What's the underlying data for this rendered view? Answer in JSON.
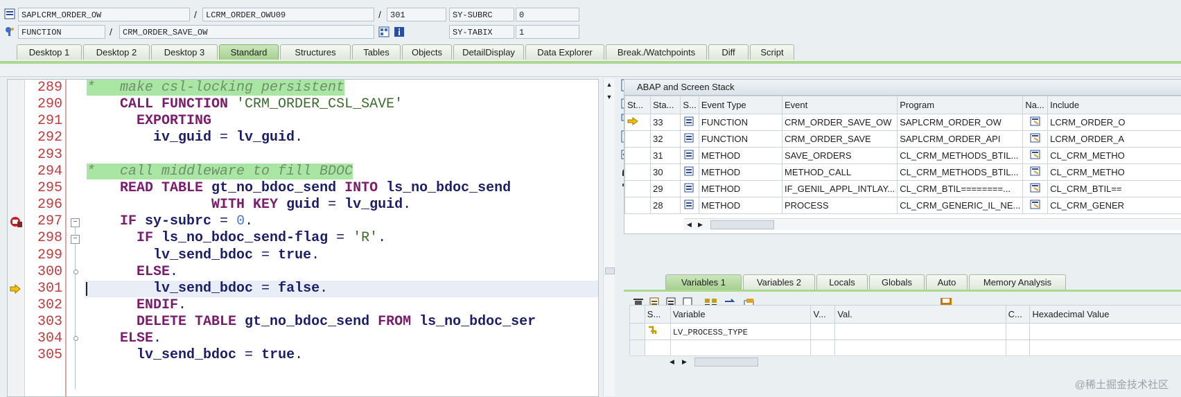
{
  "header": {
    "row1": {
      "program": "SAPLCRM_ORDER_OW",
      "include": "LCRM_ORDER_OWU09",
      "line": "301",
      "sys_field": "SY-SUBRC",
      "sys_value": "0"
    },
    "row2": {
      "type": "FUNCTION",
      "name": "CRM_ORDER_SAVE_OW",
      "sys_field": "SY-TABIX",
      "sys_value": "1"
    },
    "separator": "/"
  },
  "tabs": [
    "Desktop 1",
    "Desktop 2",
    "Desktop 3",
    "Standard",
    "Structures",
    "Tables",
    "Objects",
    "DetailDisplay",
    "Data Explorer",
    "Break./Watchpoints",
    "Diff",
    "Script"
  ],
  "active_tab": "Standard",
  "code": {
    "lines": [
      {
        "no": "289",
        "segs": [
          {
            "t": "*   make csl-locking persistent",
            "c": "cmt"
          }
        ]
      },
      {
        "no": "290",
        "segs": [
          {
            "t": "    ",
            "c": "op"
          },
          {
            "t": "CALL FUNCTION ",
            "c": "kw"
          },
          {
            "t": "'CRM_ORDER_CSL_SAVE'",
            "c": "str"
          }
        ]
      },
      {
        "no": "291",
        "segs": [
          {
            "t": "      ",
            "c": "op"
          },
          {
            "t": "EXPORTING",
            "c": "kw"
          }
        ]
      },
      {
        "no": "292",
        "segs": [
          {
            "t": "        ",
            "c": "op"
          },
          {
            "t": "iv_guid",
            "c": "id"
          },
          {
            "t": " = ",
            "c": "op"
          },
          {
            "t": "lv_guid",
            "c": "id"
          },
          {
            "t": ".",
            "c": "op"
          }
        ]
      },
      {
        "no": "293",
        "segs": []
      },
      {
        "no": "294",
        "segs": [
          {
            "t": "*   call middleware to fill BDOC",
            "c": "cmt"
          }
        ]
      },
      {
        "no": "295",
        "segs": [
          {
            "t": "    ",
            "c": "op"
          },
          {
            "t": "READ TABLE ",
            "c": "kw"
          },
          {
            "t": "gt_no_bdoc_send",
            "c": "id"
          },
          {
            "t": " INTO ",
            "c": "kw"
          },
          {
            "t": "ls_no_bdoc_send",
            "c": "id"
          }
        ]
      },
      {
        "no": "296",
        "segs": [
          {
            "t": "               ",
            "c": "op"
          },
          {
            "t": "WITH KEY ",
            "c": "kw"
          },
          {
            "t": "guid",
            "c": "id"
          },
          {
            "t": " = ",
            "c": "op"
          },
          {
            "t": "lv_guid",
            "c": "id"
          },
          {
            "t": ".",
            "c": "op"
          }
        ]
      },
      {
        "no": "297",
        "segs": [
          {
            "t": "    ",
            "c": "op"
          },
          {
            "t": "IF ",
            "c": "kw"
          },
          {
            "t": "sy-subrc",
            "c": "id"
          },
          {
            "t": " = ",
            "c": "op"
          },
          {
            "t": "0",
            "c": "num"
          },
          {
            "t": ".",
            "c": "op"
          }
        ]
      },
      {
        "no": "298",
        "segs": [
          {
            "t": "      ",
            "c": "op"
          },
          {
            "t": "IF ",
            "c": "kw"
          },
          {
            "t": "ls_no_bdoc_send-flag",
            "c": "id"
          },
          {
            "t": " = ",
            "c": "op"
          },
          {
            "t": "'R'",
            "c": "str"
          },
          {
            "t": ".",
            "c": "op"
          }
        ]
      },
      {
        "no": "299",
        "segs": [
          {
            "t": "        ",
            "c": "op"
          },
          {
            "t": "lv_send_bdoc",
            "c": "id"
          },
          {
            "t": " = ",
            "c": "op"
          },
          {
            "t": "true",
            "c": "id"
          },
          {
            "t": ".",
            "c": "op"
          }
        ]
      },
      {
        "no": "300",
        "segs": [
          {
            "t": "      ",
            "c": "op"
          },
          {
            "t": "ELSE",
            "c": "kw"
          },
          {
            "t": ".",
            "c": "op"
          }
        ]
      },
      {
        "no": "301",
        "segs": [
          {
            "t": "        ",
            "c": "op"
          },
          {
            "t": "lv_send_bdoc",
            "c": "id"
          },
          {
            "t": " = ",
            "c": "op"
          },
          {
            "t": "false",
            "c": "id"
          },
          {
            "t": ".",
            "c": "op"
          }
        ]
      },
      {
        "no": "302",
        "segs": [
          {
            "t": "      ",
            "c": "op"
          },
          {
            "t": "ENDIF",
            "c": "kw"
          },
          {
            "t": ".",
            "c": "op"
          }
        ]
      },
      {
        "no": "303",
        "segs": [
          {
            "t": "      ",
            "c": "op"
          },
          {
            "t": "DELETE TABLE ",
            "c": "kw"
          },
          {
            "t": "gt_no_bdoc_send",
            "c": "id"
          },
          {
            "t": " FROM ",
            "c": "kw"
          },
          {
            "t": "ls_no_bdoc_ser",
            "c": "id"
          }
        ]
      },
      {
        "no": "304",
        "segs": [
          {
            "t": "    ",
            "c": "op"
          },
          {
            "t": "ELSE",
            "c": "kw"
          },
          {
            "t": ".",
            "c": "op"
          }
        ]
      },
      {
        "no": "305",
        "segs": [
          {
            "t": "      ",
            "c": "op"
          },
          {
            "t": "lv_send_bdoc",
            "c": "id"
          },
          {
            "t": " = ",
            "c": "op"
          },
          {
            "t": "true",
            "c": "id"
          },
          {
            "t": ".",
            "c": "op"
          }
        ]
      }
    ],
    "current_line": "301",
    "breakpoint_line": "297"
  },
  "stack": {
    "title": "ABAP and Screen Stack",
    "columns": [
      "St...",
      "Sta...",
      "S...",
      "Event Type",
      "Event",
      "Program",
      "Na...",
      "Include"
    ],
    "rows": [
      {
        "current": true,
        "level": "33",
        "type": "FUNCTION",
        "event": "CRM_ORDER_SAVE_OW",
        "program": "SAPLCRM_ORDER_OW",
        "include": "LCRM_ORDER_O"
      },
      {
        "current": false,
        "level": "32",
        "type": "FUNCTION",
        "event": "CRM_ORDER_SAVE",
        "program": "SAPLCRM_ORDER_API",
        "include": "LCRM_ORDER_A"
      },
      {
        "current": false,
        "level": "31",
        "type": "METHOD",
        "event": "SAVE_ORDERS",
        "program": "CL_CRM_METHODS_BTIL...",
        "include": "CL_CRM_METHO"
      },
      {
        "current": false,
        "level": "30",
        "type": "METHOD",
        "event": "METHOD_CALL",
        "program": "CL_CRM_METHODS_BTIL...",
        "include": "CL_CRM_METHO"
      },
      {
        "current": false,
        "level": "29",
        "type": "METHOD",
        "event": "IF_GENIL_APPL_INTLAY...",
        "program": "CL_CRM_BTIL========...",
        "include": "CL_CRM_BTIL=="
      },
      {
        "current": false,
        "level": "28",
        "type": "METHOD",
        "event": "PROCESS",
        "program": "CL_CRM_GENERIC_IL_NE...",
        "include": "CL_CRM_GENER"
      }
    ]
  },
  "var_tabs": [
    "Variables 1",
    "Variables 2",
    "Locals",
    "Globals",
    "Auto",
    "Memory Analysis"
  ],
  "active_var_tab": "Variables 1",
  "variables": {
    "columns": [
      "S...",
      "Variable",
      "V...",
      "Val.",
      "C...",
      "Hexadecimal Value"
    ],
    "rows": [
      {
        "name": "LV_PROCESS_TYPE",
        "value": "",
        "hex": ""
      }
    ]
  },
  "watermark": "@稀土掘金技术社区"
}
